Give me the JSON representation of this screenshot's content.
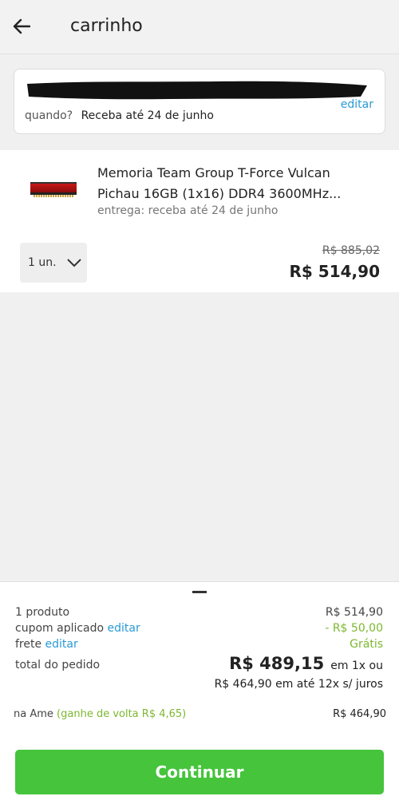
{
  "header": {
    "title": "carrinho",
    "back_icon": "arrow-left-icon"
  },
  "address": {
    "edit_label": "editar",
    "when_label": "quando?",
    "when_value": "Receba até 24 de junho"
  },
  "product": {
    "title": "Memoria Team Group T-Force Vulcan Pichau 16GB (1x16) DDR4 3600MHz...",
    "delivery": "entrega: receba até 24 de junho",
    "quantity": "1 un.",
    "price_old": "R$ 885,02",
    "price_now": "R$ 514,90"
  },
  "summary": {
    "products_label": "1 produto",
    "products_value": "R$ 514,90",
    "coupon_label": "cupom aplicado",
    "coupon_edit": "editar",
    "coupon_value": "- R$ 50,00",
    "shipping_label": "frete",
    "shipping_edit": "editar",
    "shipping_value": "Grátis",
    "total_label": "total do pedido",
    "total_value": "R$ 489,15",
    "total_suffix": "em 1x ou",
    "installments": "R$ 464,90 em até 12x s/ juros",
    "ame_label": "na Ame",
    "ame_cashback": "(ganhe de volta R$ 4,65)",
    "ame_value": "R$ 464,90",
    "continue_label": "Continuar"
  },
  "colors": {
    "link": "#2a9ad6",
    "green_text": "#7cb82f",
    "button": "#45c43c"
  }
}
